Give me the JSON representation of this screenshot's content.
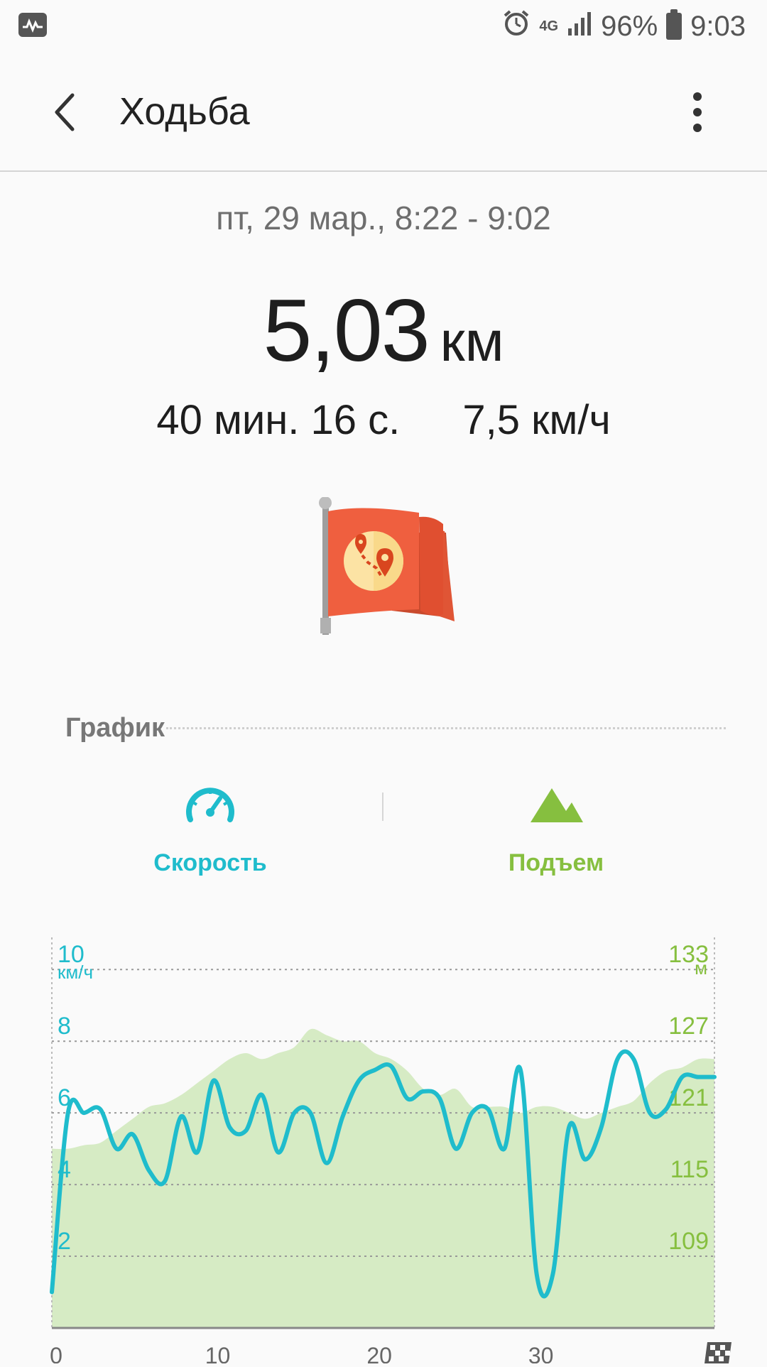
{
  "status_bar": {
    "network": "4G",
    "battery": "96%",
    "time": "9:03"
  },
  "app_bar": {
    "title": "Ходьба"
  },
  "summary": {
    "date_range": "пт, 29 мар., 8:22 - 9:02",
    "distance_value": "5,03",
    "distance_unit": "км",
    "duration": "40 мин. 16 с.",
    "avg_speed": "7,5 км/ч"
  },
  "graph_section": {
    "title": "График",
    "speed_label": "Скорость",
    "elevation_label": "Подъем"
  },
  "colors": {
    "speed": "#1fbccc",
    "elevation_line": "#86bf3f",
    "elevation_fill": "#d6ebc4",
    "flag": "#ef5f3f"
  },
  "chart_data": {
    "type": "line",
    "x": [
      0,
      1,
      2,
      3,
      4,
      5,
      6,
      7,
      8,
      9,
      10,
      11,
      12,
      13,
      14,
      15,
      16,
      17,
      18,
      19,
      20,
      21,
      22,
      23,
      24,
      25,
      26,
      27,
      28,
      29,
      30,
      31,
      32,
      33,
      34,
      35,
      36,
      37,
      38,
      39,
      40,
      41
    ],
    "x_ticks": [
      "0",
      "10",
      "20",
      "30"
    ],
    "xlim": [
      0,
      41
    ],
    "y_left_label": "км/ч",
    "y_left_ticks": [
      "2",
      "4",
      "6",
      "8",
      "10"
    ],
    "y_left_lim": [
      0,
      10.5
    ],
    "y_right_label": "м",
    "y_right_ticks": [
      "109",
      "115",
      "121",
      "127",
      "133"
    ],
    "y_right_lim": [
      103,
      134.5
    ],
    "series": [
      {
        "axis": "left",
        "values": [
          1.0,
          6.0,
          6.0,
          6.1,
          5.0,
          5.4,
          4.4,
          4.1,
          5.9,
          4.9,
          6.9,
          5.6,
          5.5,
          6.5,
          4.9,
          6.0,
          6.0,
          4.6,
          5.9,
          6.9,
          7.2,
          7.3,
          6.4,
          6.6,
          6.4,
          5.0,
          6.0,
          6.1,
          5.0,
          7.2,
          1.5,
          1.5,
          5.6,
          4.7,
          5.6,
          7.5,
          7.5,
          6.0,
          6.1,
          7.0,
          7.0,
          7.0
        ]
      },
      {
        "axis": "right",
        "values": [
          118.0,
          118.0,
          118.3,
          118.5,
          119.5,
          120.5,
          121.5,
          121.8,
          122.5,
          123.5,
          124.5,
          125.5,
          126.0,
          125.5,
          126.0,
          126.5,
          128.0,
          127.5,
          127.0,
          127.0,
          126.0,
          125.5,
          124.5,
          123.0,
          122.5,
          123.0,
          121.5,
          121.5,
          121.5,
          121.0,
          121.5,
          121.5,
          121.0,
          120.5,
          121.0,
          121.5,
          122.0,
          123.5,
          124.5,
          124.8,
          125.5,
          125.5
        ]
      }
    ]
  }
}
